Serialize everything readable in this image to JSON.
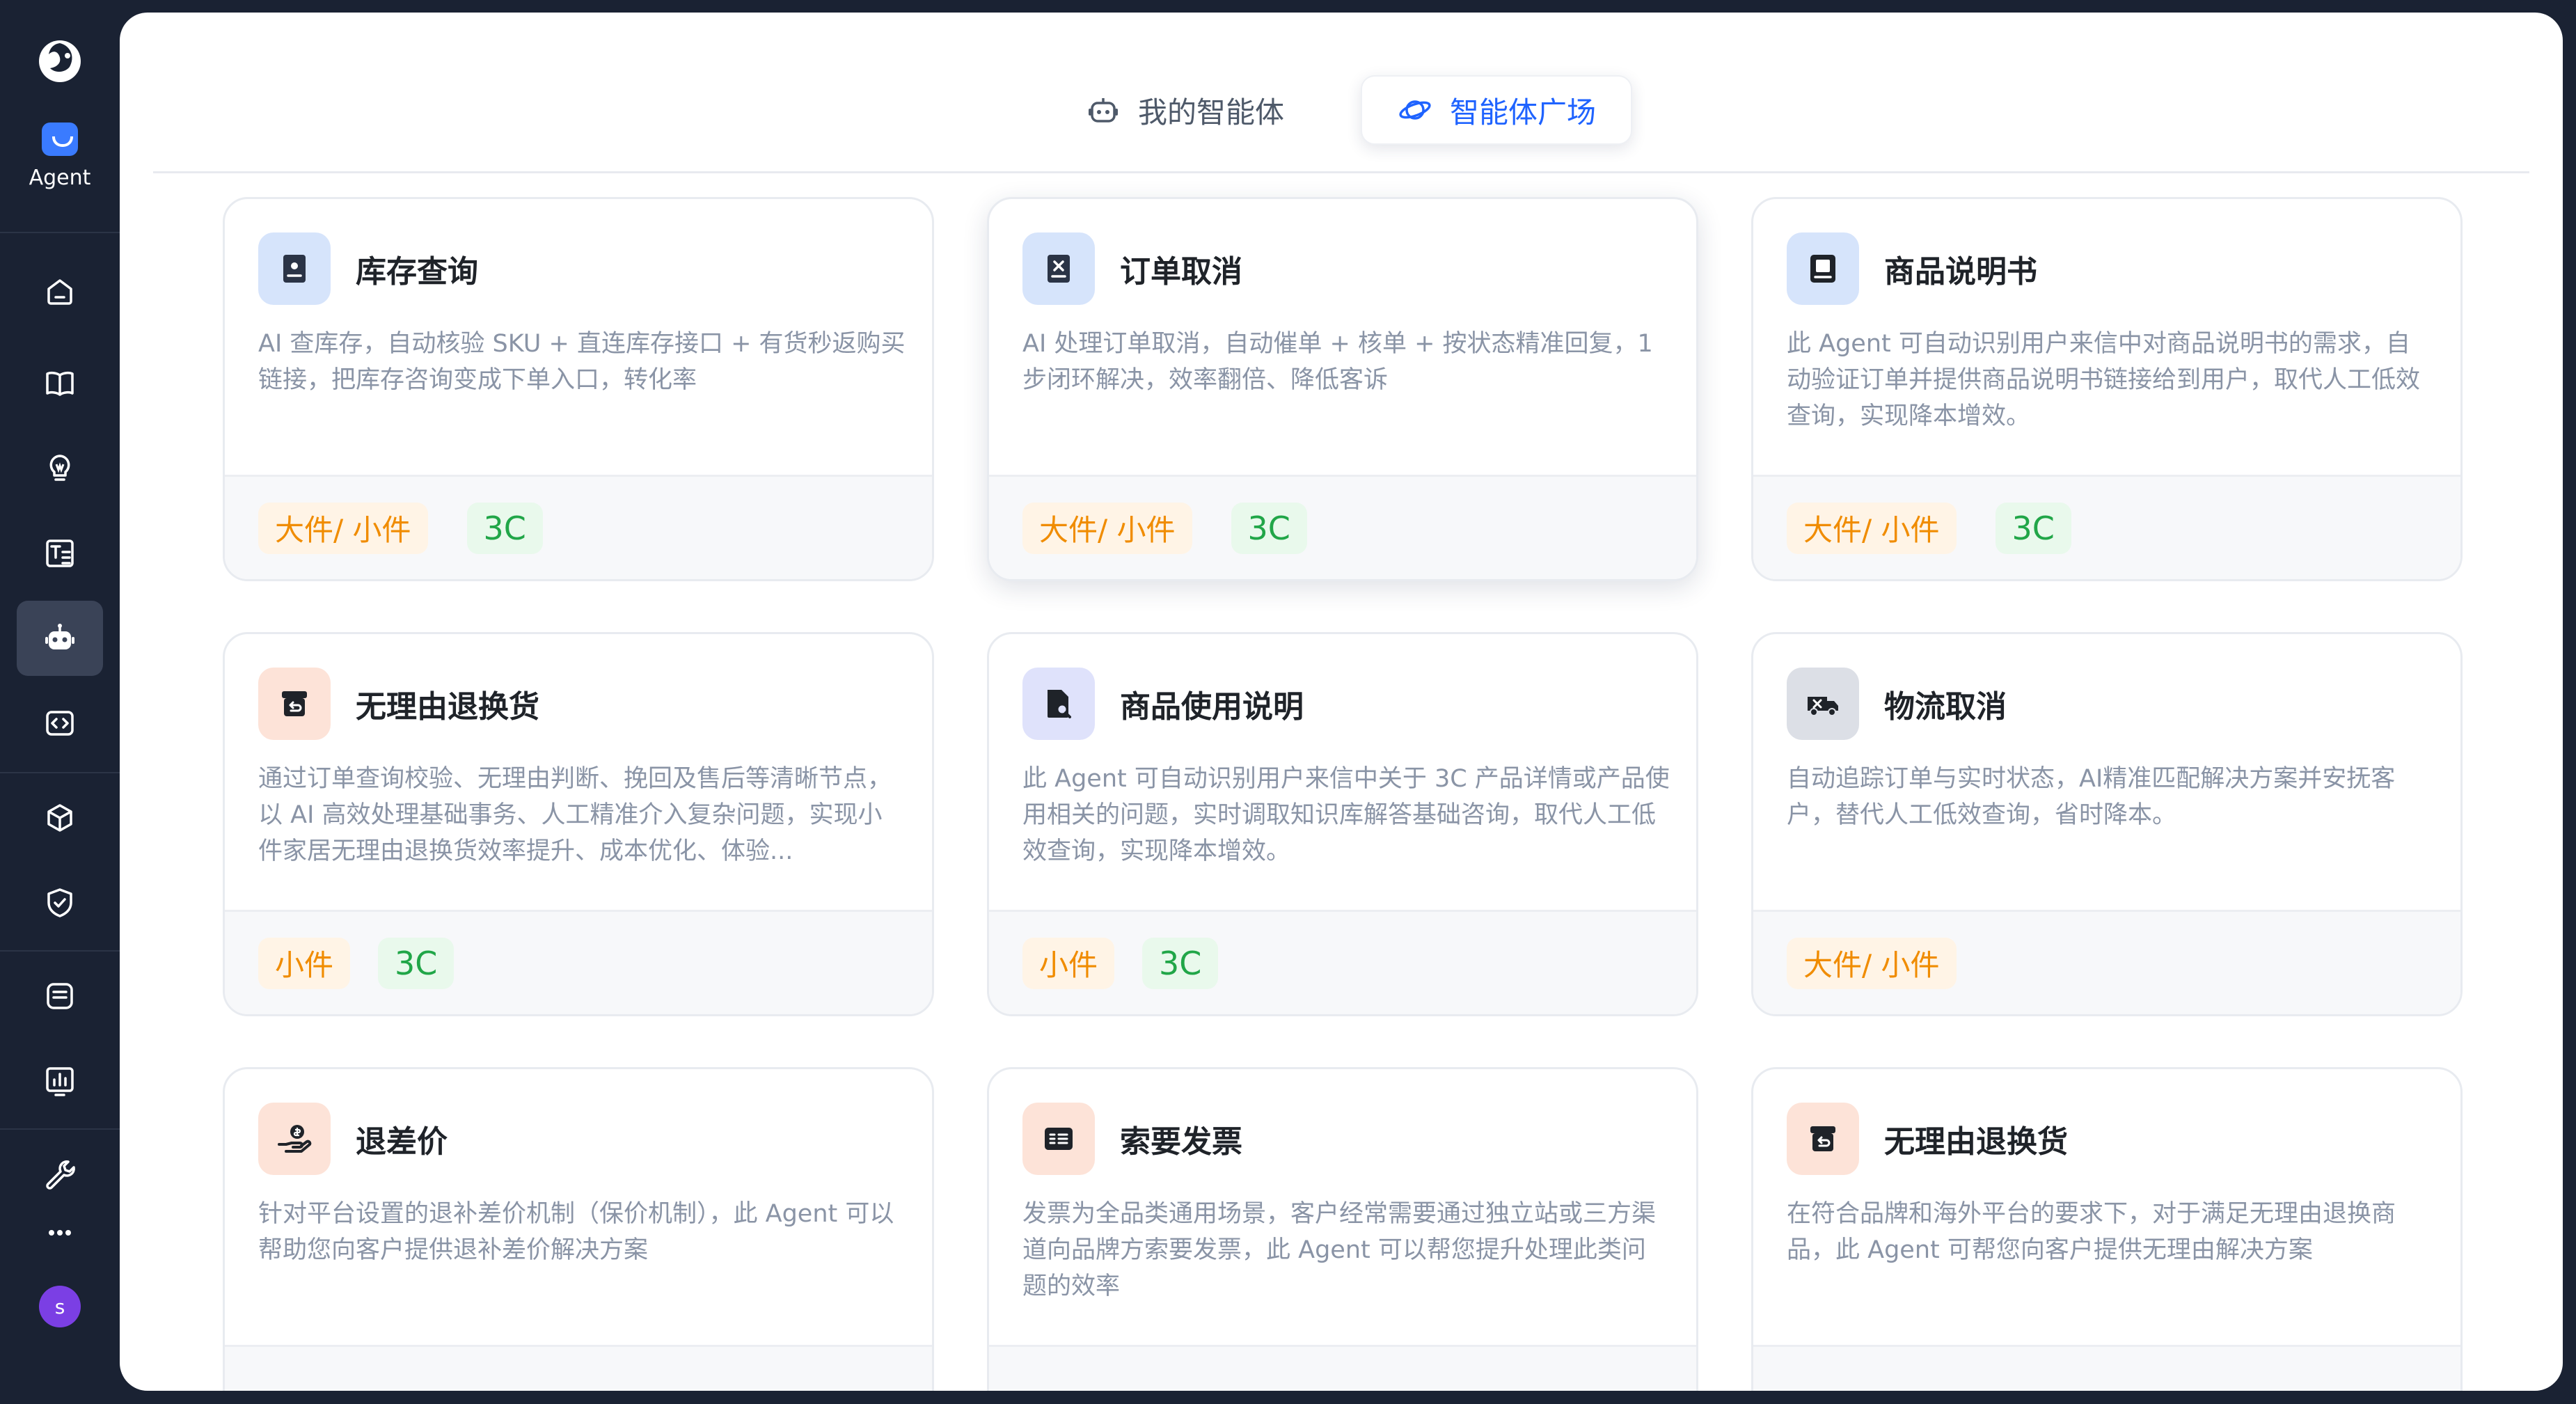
{
  "sidebar": {
    "agent_label": "Agent",
    "avatar_initial": "s",
    "items": [
      "home-icon",
      "book-icon",
      "bulb-icon",
      "text-tool-icon",
      "robot-icon",
      "code-icon",
      "cube-icon",
      "shield-check-icon",
      "chat-log-icon",
      "chart-icon",
      "wrench-icon",
      "more-icon"
    ]
  },
  "tabs": [
    {
      "label": "我的智能体",
      "active": false
    },
    {
      "label": "智能体广场",
      "active": true
    }
  ],
  "colors": {
    "accent": "#1f63ff",
    "size_tag": "#f08c00",
    "cat_tag": "#21a648"
  },
  "cards": [
    {
      "title": "库存查询",
      "desc": "AI 查库存，自动核验 SKU + 直连库存接口 + 有货秒返购买链接，把库存咨询变成下单入口，转化率",
      "tags": [
        "大件/ 小件",
        "3C"
      ],
      "icon": "inventory-icon"
    },
    {
      "title": "订单取消",
      "desc": "AI 处理订单取消，自动催单 + 核单 + 按状态精准回复，1 步闭环解决，效率翻倍、降低客诉",
      "tags": [
        "大件/ 小件",
        "3C"
      ],
      "icon": "order-cancel-icon"
    },
    {
      "title": "商品说明书",
      "desc": "此 Agent 可自动识别用户来信中对商品说明书的需求，自动验证订单并提供商品说明书链接给到用户，取代人工低效查询，实现降本增效。",
      "tags": [
        "大件/ 小件",
        "3C"
      ],
      "icon": "manual-book-icon"
    },
    {
      "title": "无理由退换货",
      "desc": "通过订单查询校验、无理由判断、挽回及售后等清晰节点，以 AI 高效处理基础事务、人工精准介入复杂问题，实现小件家居无理由退换货效率提升、成本优化、体验...",
      "tags": [
        "小件",
        "3C"
      ],
      "icon": "return-box-icon"
    },
    {
      "title": "商品使用说明",
      "desc": "此 Agent 可自动识别用户来信中关于 3C 产品详情或产品使用相关的问题，实时调取知识库解答基础咨询，取代人工低效查询，实现降本增效。",
      "tags": [
        "小件",
        "3C"
      ],
      "icon": "doc-search-icon"
    },
    {
      "title": "物流取消",
      "desc": "自动追踪订单与实时状态，AI精准匹配解决方案并安抚客户，替代人工低效查询，省时降本。",
      "tags": [
        "大件/ 小件"
      ],
      "icon": "truck-cancel-icon"
    },
    {
      "title": "退差价",
      "desc": "针对平台设置的退补差价机制（保价机制），此 Agent 可以帮助您向客户提供退补差价解决方案",
      "tags": [],
      "icon": "refund-hand-icon"
    },
    {
      "title": "索要发票",
      "desc": "发票为全品类通用场景，客户经常需要通过独立站或三方渠道向品牌方索要发票，此 Agent 可以帮您提升处理此类问题的效率",
      "tags": [],
      "icon": "invoice-icon"
    },
    {
      "title": "无理由退换货",
      "desc": "在符合品牌和海外平台的要求下，对于满足无理由退换商品，此 Agent 可帮您向客户提供无理由解决方案",
      "tags": [],
      "icon": "return-box-icon"
    }
  ]
}
